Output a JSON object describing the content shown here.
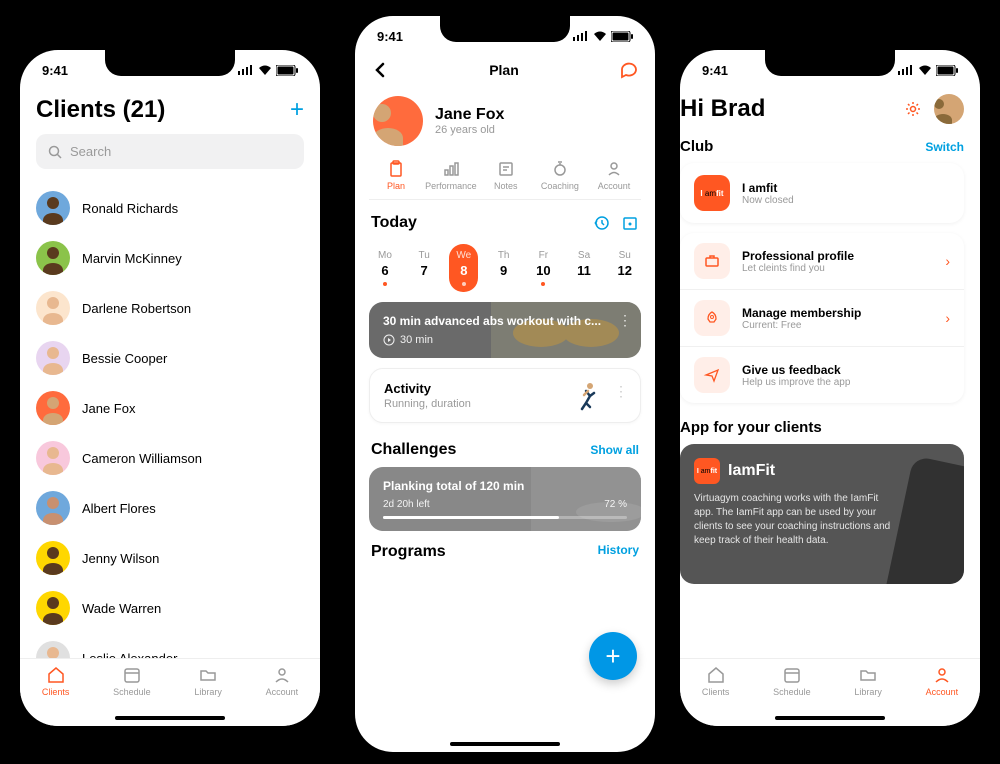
{
  "statusbar": {
    "time": "9:41"
  },
  "phone1": {
    "title": "Clients (21)",
    "search_placeholder": "Search",
    "clients": [
      {
        "name": "Ronald Richards",
        "bg": "#6fa8dc",
        "skin": "#5a3a1e"
      },
      {
        "name": "Marvin McKinney",
        "bg": "#8bc34a",
        "skin": "#5a3a1e"
      },
      {
        "name": "Darlene Robertson",
        "bg": "#fce5cd",
        "skin": "#e8b890"
      },
      {
        "name": "Bessie Cooper",
        "bg": "#e8d5f0",
        "skin": "#e8b890"
      },
      {
        "name": "Jane Fox",
        "bg": "#ff6b3d",
        "skin": "#d4a574"
      },
      {
        "name": "Cameron Williamson",
        "bg": "#f8c8dc",
        "skin": "#e8b890"
      },
      {
        "name": "Albert Flores",
        "bg": "#6fa8dc",
        "skin": "#c89070"
      },
      {
        "name": "Jenny Wilson",
        "bg": "#ffd700",
        "skin": "#5a3a1e"
      },
      {
        "name": "Wade Warren",
        "bg": "#ffd700",
        "skin": "#5a3a1e"
      },
      {
        "name": "Leslie Alexander",
        "bg": "#e0e0e0",
        "skin": "#e8b890"
      }
    ],
    "nav": {
      "clients": "Clients",
      "schedule": "Schedule",
      "library": "Library",
      "account": "Account"
    }
  },
  "phone2": {
    "header_title": "Plan",
    "profile": {
      "name": "Jane Fox",
      "sub": "26 years old"
    },
    "tabs": {
      "plan": "Plan",
      "performance": "Performance",
      "notes": "Notes",
      "coaching": "Coaching",
      "account": "Account"
    },
    "today": "Today",
    "days": [
      {
        "abbr": "Mo",
        "num": "6",
        "dot": true,
        "active": false
      },
      {
        "abbr": "Tu",
        "num": "7",
        "dot": false,
        "active": false
      },
      {
        "abbr": "We",
        "num": "8",
        "dot": true,
        "active": true
      },
      {
        "abbr": "Th",
        "num": "9",
        "dot": false,
        "active": false
      },
      {
        "abbr": "Fr",
        "num": "10",
        "dot": true,
        "active": false
      },
      {
        "abbr": "Sa",
        "num": "11",
        "dot": false,
        "active": false
      },
      {
        "abbr": "Su",
        "num": "12",
        "dot": false,
        "active": false
      }
    ],
    "workout": {
      "title": "30 min advanced abs workout with c...",
      "duration": "30 min"
    },
    "activity": {
      "title": "Activity",
      "sub": "Running, duration"
    },
    "challenges": {
      "title": "Challenges",
      "show_all": "Show all",
      "item_title": "Planking total of 120 min",
      "left": "2d 20h left",
      "pct": "72 %",
      "progress": 72
    },
    "programs": {
      "title": "Programs",
      "history": "History"
    }
  },
  "phone3": {
    "greeting": "Hi Brad",
    "club_title": "Club",
    "switch": "Switch",
    "club_items": [
      {
        "title": "I amfit",
        "sub": "Now closed",
        "type": "logo",
        "chev": false
      },
      {
        "title": "Professional profile",
        "sub": "Let cleints find you",
        "icon": "briefcase",
        "chev": true
      },
      {
        "title": "Manage membership",
        "sub": "Current: Free",
        "icon": "rocket",
        "chev": true
      },
      {
        "title": "Give us feedback",
        "sub": "Help us improve the app",
        "icon": "send",
        "chev": false
      }
    ],
    "app_section": "App for your clients",
    "app_card": {
      "title": "IamFit",
      "desc": "Virtuagym coaching works with the IamFit app. The IamFit app can be used by your clients to see your coaching instructions and keep track of their health data."
    },
    "nav": {
      "clients": "Clients",
      "schedule": "Schedule",
      "library": "Library",
      "account": "Account"
    }
  }
}
